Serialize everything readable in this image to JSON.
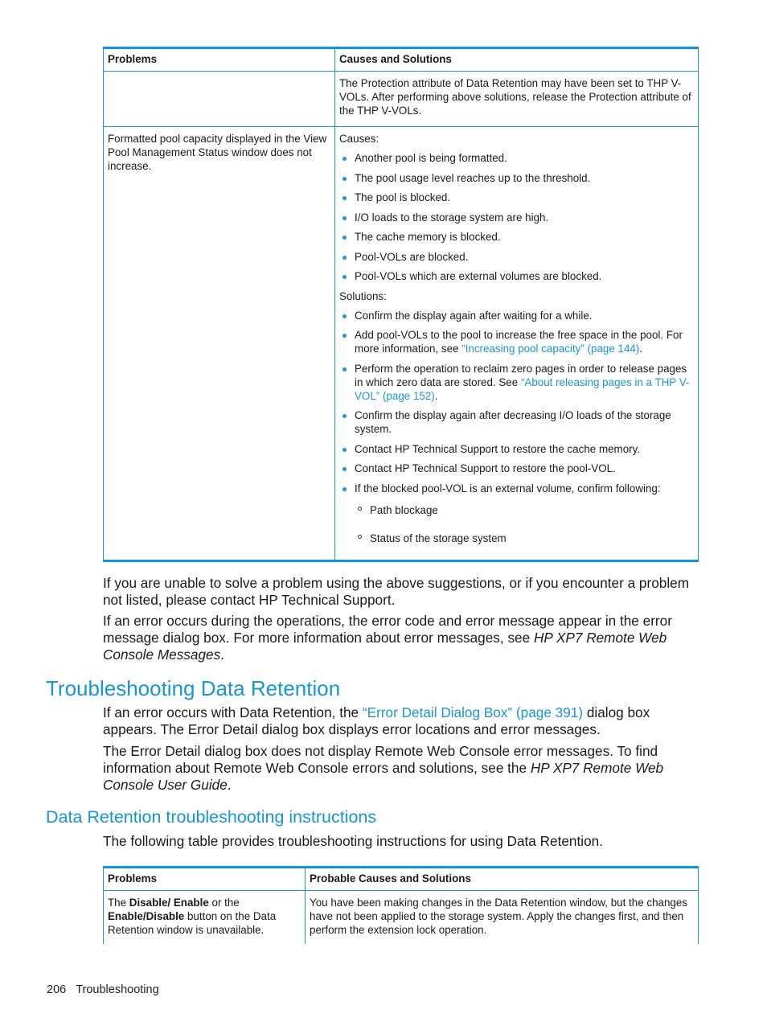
{
  "table1": {
    "headers": [
      "Problems",
      "Causes and Solutions"
    ],
    "continued_row": {
      "problem": "",
      "solution": "The Protection attribute of Data Retention may have been set to THP V-VOLs. After performing above solutions, release the Protection attribute of the THP V-VOLs."
    },
    "row2": {
      "problem": "Formatted pool capacity displayed in the View Pool Management Status window does not increase.",
      "causes_label": "Causes:",
      "causes": [
        "Another pool is being formatted.",
        "The pool usage level reaches up to the threshold.",
        "The pool is blocked.",
        "I/O loads to the storage system are high.",
        "The cache memory is blocked.",
        "Pool-VOLs are blocked.",
        "Pool-VOLs which are external volumes are blocked."
      ],
      "solutions_label": "Solutions:",
      "solutions": {
        "s1": "Confirm the display again after waiting for a while.",
        "s2_text": "Add pool-VOLs to the pool to increase the free space in the pool. For more information, see ",
        "s2_link": "“Increasing pool capacity” (page 144)",
        "s2_end": ".",
        "s3_text": "Perform the operation to reclaim zero pages in order to release pages in which zero data are stored. See ",
        "s3_link": "“About releasing pages in a THP V-VOL” (page 152)",
        "s3_end": ".",
        "s4": "Confirm the display again after decreasing I/O loads of the storage system.",
        "s5": "Contact HP Technical Support to restore the cache memory.",
        "s6": "Contact HP Technical Support to restore the pool-VOL.",
        "s7": "If the blocked pool-VOL is an external volume, confirm following:",
        "s7_sub": [
          "Path blockage",
          "Status of the storage system"
        ]
      }
    }
  },
  "para1": "If you are unable to solve a problem using the above suggestions, or if you encounter a problem not listed, please contact HP Technical Support.",
  "para2": {
    "text": "If an error occurs during the operations, the error code and error message appear in the error message dialog box. For more information about error messages, see ",
    "italic": "HP XP7 Remote Web Console Messages",
    "end": "."
  },
  "section": {
    "title": "Troubleshooting Data Retention",
    "p1_text": "If an error occurs with Data Retention, the ",
    "p1_link": "“Error Detail Dialog Box” (page 391)",
    "p1_end": " dialog box appears. The Error Detail dialog box displays error locations and error messages.",
    "p2_text": "The Error Detail dialog box does not display Remote Web Console error messages. To find information about Remote Web Console errors and solutions, see the ",
    "p2_italic": "HP XP7 Remote Web Console User Guide",
    "p2_end": "."
  },
  "subsection": {
    "title": "Data Retention troubleshooting instructions",
    "intro": "The following table provides troubleshooting instructions for using Data Retention."
  },
  "table2": {
    "headers": [
      "Problems",
      "Probable Causes and Solutions"
    ],
    "row1": {
      "p_the": "The ",
      "p_b1": "Disable/ Enable",
      "p_or": " or the ",
      "p_b2": "Enable/Disable",
      "p_rest": " button on the Data Retention window is unavailable.",
      "solution": "You have been making changes in the Data Retention window, but the changes have not been applied to the storage system. Apply the changes first, and then perform the extension lock operation."
    }
  },
  "footer": {
    "page_number": "206",
    "section": "Troubleshooting"
  }
}
